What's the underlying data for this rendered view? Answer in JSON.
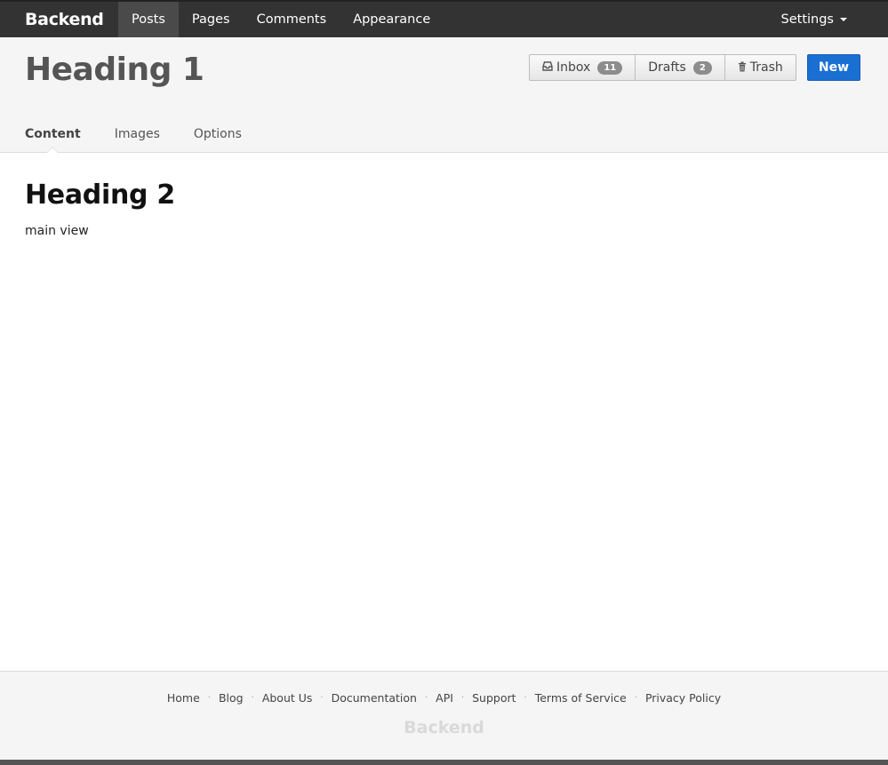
{
  "topnav": {
    "brand": "Backend",
    "items": [
      {
        "label": "Posts",
        "active": true
      },
      {
        "label": "Pages",
        "active": false
      },
      {
        "label": "Comments",
        "active": false
      },
      {
        "label": "Appearance",
        "active": false
      }
    ],
    "settings_label": "Settings"
  },
  "header": {
    "title": "Heading 1",
    "buttons": {
      "inbox": {
        "label": "Inbox",
        "count": "11",
        "icon": "inbox-icon"
      },
      "drafts": {
        "label": "Drafts",
        "count": "2"
      },
      "trash": {
        "label": "Trash",
        "icon": "trash-icon"
      }
    },
    "new_label": "New",
    "tabs": [
      {
        "label": "Content",
        "active": true
      },
      {
        "label": "Images",
        "active": false
      },
      {
        "label": "Options",
        "active": false
      }
    ]
  },
  "main": {
    "heading": "Heading 2",
    "text": "main view"
  },
  "footer": {
    "links": [
      "Home",
      "Blog",
      "About Us",
      "Documentation",
      "API",
      "Support",
      "Terms of Service",
      "Privacy Policy"
    ],
    "brand": "Backend"
  },
  "colors": {
    "topbar": "#333333",
    "accent": "#1a6fd2"
  }
}
